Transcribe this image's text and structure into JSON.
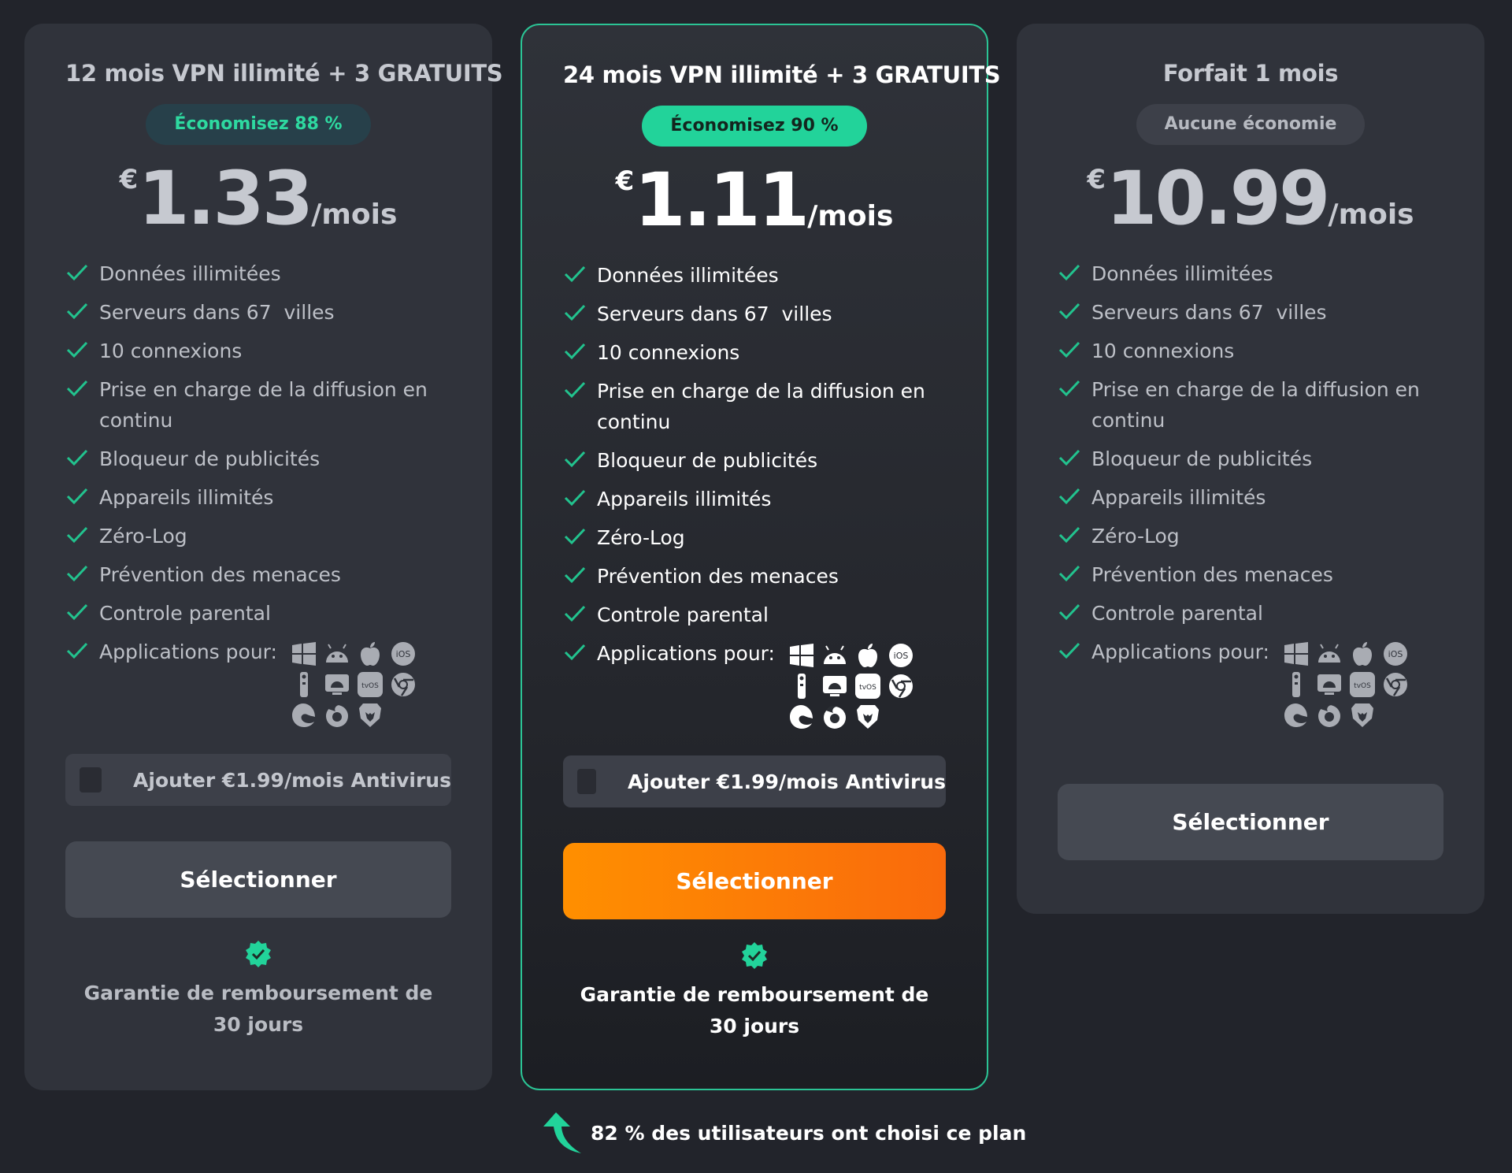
{
  "plans": [
    {
      "title": "12 mois VPN illimité + 3 GRATUITS",
      "badge": "Économisez 88 %",
      "currency": "€",
      "amount": "1.33",
      "per": "/mois",
      "features": [
        "Données illimitées",
        "Serveurs dans 67  villes",
        "10 connexions",
        "Prise en charge de la diffusion en continu",
        "Bloqueur de publicités",
        "Appareils illimités",
        "Zéro-Log",
        "Prévention des menaces",
        "Controle parental"
      ],
      "apps_label": "Applications pour:",
      "addon": "Ajouter €1.99/mois Antivirus",
      "select": "Sélectionner",
      "guarantee": "Garantie de remboursement de 30 jours"
    },
    {
      "title": "24 mois VPN illimité + 3 GRATUITS",
      "badge": "Économisez 90 %",
      "currency": "€",
      "amount": "1.11",
      "per": "/mois",
      "features": [
        "Données illimitées",
        "Serveurs dans 67  villes",
        "10 connexions",
        "Prise en charge de la diffusion en continu",
        "Bloqueur de publicités",
        "Appareils illimités",
        "Zéro-Log",
        "Prévention des menaces",
        "Controle parental"
      ],
      "apps_label": "Applications pour:",
      "addon": "Ajouter €1.99/mois Antivirus",
      "select": "Sélectionner",
      "guarantee": "Garantie de remboursement de 30 jours"
    },
    {
      "title": "Forfait 1 mois",
      "badge": "Aucune économie",
      "currency": "€",
      "amount": "10.99",
      "per": "/mois",
      "features": [
        "Données illimitées",
        "Serveurs dans 67  villes",
        "10 connexions",
        "Prise en charge de la diffusion en continu",
        "Bloqueur de publicités",
        "Appareils illimités",
        "Zéro-Log",
        "Prévention des menaces",
        "Controle parental"
      ],
      "apps_label": "Applications pour:",
      "select": "Sélectionner"
    }
  ],
  "app_icons": {
    "ios_label": "iOS",
    "tvos_label": "tvOS",
    "names": [
      "windows-icon",
      "android-icon",
      "apple-icon",
      "ios-icon",
      "fire-tv-remote-icon",
      "android-tv-icon",
      "tvos-icon",
      "chrome-icon",
      "edge-icon",
      "firefox-icon",
      "brave-icon"
    ]
  },
  "footer": {
    "text": "82 % des utilisateurs ont choisi ce plan"
  },
  "colors": {
    "background": "#22242b",
    "card": "#30333b",
    "accent_green": "#22d39a",
    "cta_orange": "#ff8f00",
    "button_grey": "#454952"
  }
}
